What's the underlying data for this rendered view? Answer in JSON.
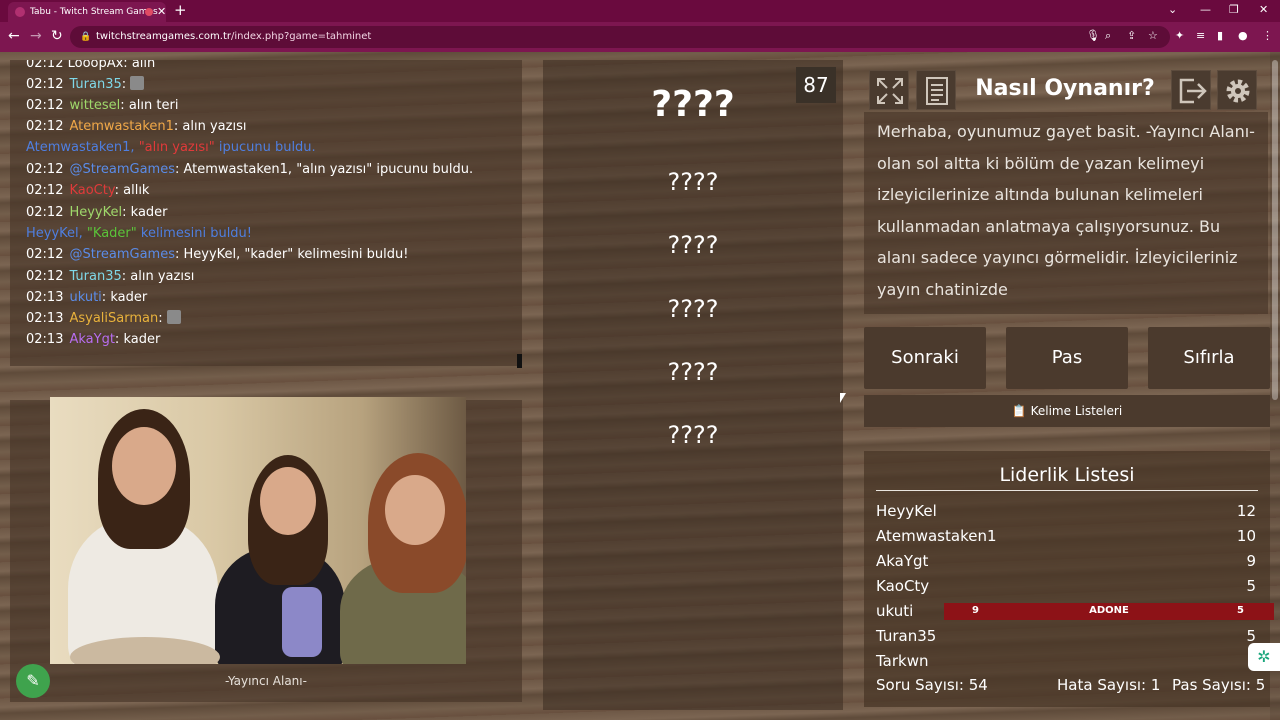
{
  "browser": {
    "tab_title": "Tabu - Twitch Stream Games",
    "url_host": "twitchstreamgames.com.tr",
    "url_path": "/index.php?game=tahminet"
  },
  "chat": {
    "top_partial": "02:12 LooopAx: alın",
    "lines": [
      {
        "time": "02:12",
        "user": "Turan35",
        "msg": ""
      },
      {
        "time": "02:12",
        "user": "wittesel",
        "msg": "alın teri"
      },
      {
        "time": "02:12",
        "user": "Atemwastaken1",
        "msg": "alın yazısı"
      },
      {
        "system_user": "Atemwastaken1, ",
        "system_hint": "\"alın yazısı\"",
        "system_rest": " ipucunu buldu."
      },
      {
        "time": "02:12",
        "user": "@StreamGames",
        "msg": "Atemwastaken1, \"alın yazısı\" ipucunu buldu."
      },
      {
        "time": "02:12",
        "user": "KaoCty",
        "msg": "allık"
      },
      {
        "time": "02:12",
        "user": "HeyyKel",
        "msg": "kader"
      },
      {
        "system_user": "HeyyKel, ",
        "system_hint": "\"Kader\"",
        "system_rest": " kelimesini buldu!"
      },
      {
        "time": "02:12",
        "user": "@StreamGames",
        "msg": "HeyyKel, \"kader\" kelimesini buldu!"
      },
      {
        "time": "02:12",
        "user": "Turan35",
        "msg": "alın yazısı"
      },
      {
        "time": "02:13",
        "user": "ukuti",
        "msg": "kader"
      },
      {
        "time": "02:13",
        "user": "AsyaliSarman",
        "msg": ""
      },
      {
        "time": "02:13",
        "user": "AkaYgt",
        "msg": "kader"
      }
    ]
  },
  "streamer": {
    "label": "-Yayıncı Alanı-"
  },
  "words": {
    "counter": "87",
    "main": "????",
    "hidden": [
      "????",
      "????",
      "????",
      "????",
      "????"
    ]
  },
  "howto": {
    "title": "Nasıl Oynanır?",
    "text": "Merhaba, oyunumuz gayet basit. -Yayıncı Alanı- olan sol altta ki bölüm de yazan kelimeyi izleyicilerinize altında bulunan kelimeleri kullanmadan anlatmaya çalışıyorsunuz. Bu alanı sadece yayıncı görmelidir. İzleyicileriniz yayın chatinizde"
  },
  "actions": {
    "next": "Sonraki",
    "pass": "Pas",
    "reset": "Sıfırla",
    "word_lists": "Kelime Listeleri"
  },
  "leaderboard": {
    "title": "Liderlik Listesi",
    "rows": [
      {
        "name": "HeyyKel",
        "score": "12"
      },
      {
        "name": "Atemwastaken1",
        "score": "10"
      },
      {
        "name": "AkaYgt",
        "score": "9"
      },
      {
        "name": "KaoCty",
        "score": "5"
      },
      {
        "name": "ukuti",
        "score": ""
      },
      {
        "name": "Turan35",
        "score": "5"
      },
      {
        "name": "Tarkwn",
        "score": ""
      }
    ],
    "banner": {
      "left": "9",
      "center": "ADONE",
      "right": "5"
    }
  },
  "stats": {
    "questions": "Soru Sayısı: 54",
    "errors": "Hata Sayısı: 1",
    "passes": "Pas Sayısı: 5"
  },
  "colors": {
    "chrome": "#7d1650",
    "button": "#4b3a2d",
    "banner": "#8d1217"
  }
}
